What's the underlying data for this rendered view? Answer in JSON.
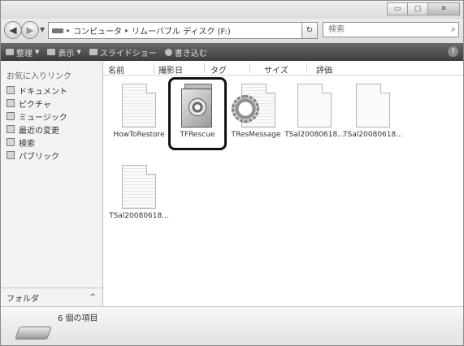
{
  "window": {
    "controls": [
      {
        "name": "minimize-button",
        "glyph": "▭"
      },
      {
        "name": "maximize-button",
        "glyph": "▢"
      },
      {
        "name": "close-button",
        "glyph": "✕"
      }
    ]
  },
  "address": {
    "segments": [
      "コンピュータ",
      "リムーバブル ディスク (F:)"
    ]
  },
  "search": {
    "placeholder": "検索"
  },
  "toolbar": {
    "organize": "整理",
    "views": "表示",
    "slideshow": "スライドショー",
    "burn": "書き込む",
    "help_glyph": "?"
  },
  "nav": {
    "favorites_header": "お気に入りリンク",
    "items": [
      "ドキュメント",
      "ピクチャ",
      "ミュージック",
      "最近の変更",
      "検索",
      "パブリック"
    ],
    "folders_label": "フォルダ",
    "folders_caret": "^"
  },
  "columns": [
    "名前",
    "撮影日",
    "タグ",
    "サイズ",
    "評価"
  ],
  "files": [
    {
      "label": "HowToRestore",
      "icon": "text-document-icon"
    },
    {
      "label": "TFRescue",
      "icon": "application-icon"
    },
    {
      "label": "TResMessage",
      "icon": "settings-file-icon"
    },
    {
      "label": "TSal20080618...",
      "icon": "blank-document-icon"
    },
    {
      "label": "TSal20080618...",
      "icon": "blank-document-icon"
    },
    {
      "label": "TSal20080618...",
      "icon": "text-document-icon"
    }
  ],
  "status": {
    "item_count": "6 個の項目"
  }
}
